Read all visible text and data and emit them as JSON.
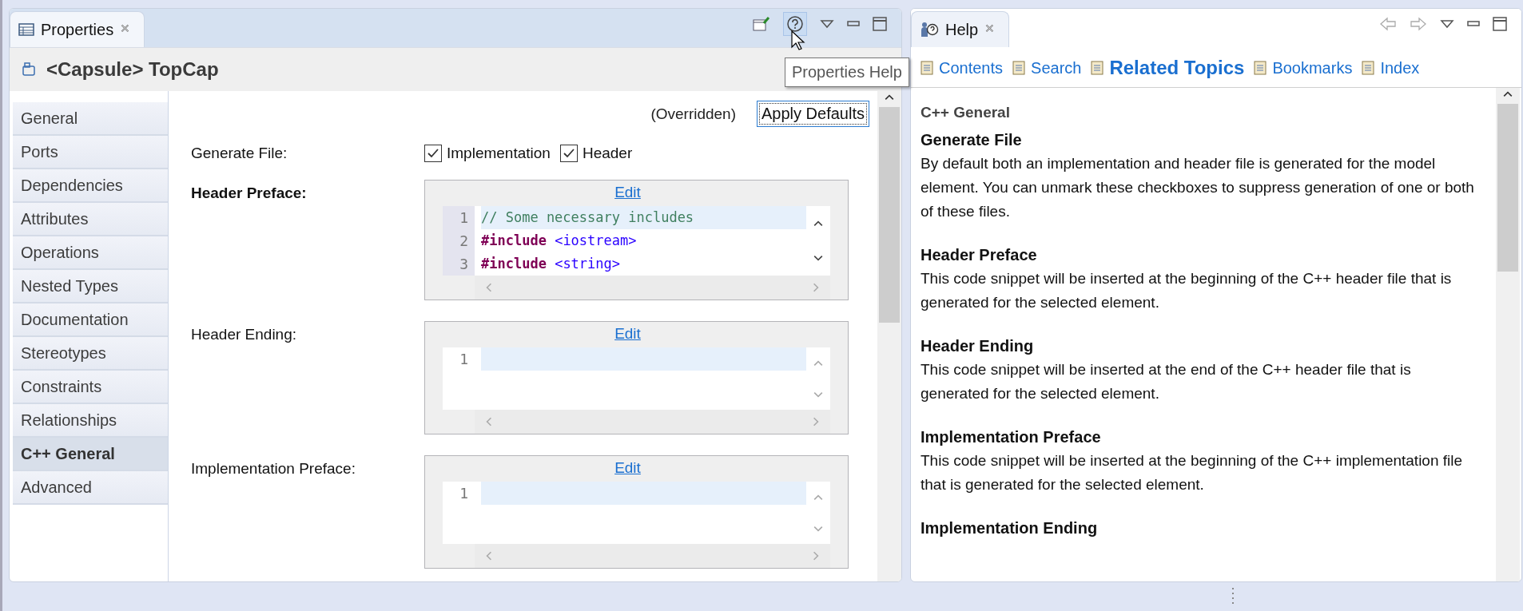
{
  "properties": {
    "tab": {
      "title": "Properties"
    },
    "heading": "<Capsule> TopCap",
    "sidebar": {
      "items": [
        {
          "label": "General",
          "selected": false
        },
        {
          "label": "Ports",
          "selected": false
        },
        {
          "label": "Dependencies",
          "selected": false
        },
        {
          "label": "Attributes",
          "selected": false
        },
        {
          "label": "Operations",
          "selected": false
        },
        {
          "label": "Nested Types",
          "selected": false
        },
        {
          "label": "Documentation",
          "selected": false
        },
        {
          "label": "Stereotypes",
          "selected": false
        },
        {
          "label": "Constraints",
          "selected": false
        },
        {
          "label": "Relationships",
          "selected": false
        },
        {
          "label": "C++ General",
          "selected": true
        },
        {
          "label": "Advanced",
          "selected": false
        }
      ]
    },
    "form": {
      "overridden_note": "(Overridden)",
      "apply_button": "Apply Defaults",
      "generate_file": {
        "label": "Generate File:",
        "options": [
          {
            "label": "Implementation",
            "checked": true
          },
          {
            "label": "Header",
            "checked": true
          }
        ]
      },
      "code_sections": [
        {
          "label": "Header Preface:",
          "emphasized": true,
          "edit_link": "Edit",
          "lines": [
            {
              "number": "1",
              "current": true,
              "tokens": [
                {
                  "kind": "comment",
                  "text": "// Some necessary includes"
                }
              ]
            },
            {
              "number": "2",
              "current": false,
              "tokens": [
                {
                  "kind": "keyword",
                  "text": "#include"
                },
                {
                  "kind": "header",
                  "text": "<iostream>"
                }
              ]
            },
            {
              "number": "3",
              "current": false,
              "tokens": [
                {
                  "kind": "keyword",
                  "text": "#include"
                },
                {
                  "kind": "header",
                  "text": "<string>"
                }
              ]
            }
          ]
        },
        {
          "label": "Header Ending:",
          "emphasized": false,
          "edit_link": "Edit",
          "lines": [
            {
              "number": "1",
              "current": true
            }
          ]
        },
        {
          "label": "Implementation Preface:",
          "emphasized": false,
          "edit_link": "Edit",
          "lines": [
            {
              "number": "1",
              "current": true
            }
          ]
        }
      ]
    }
  },
  "tooltip": "Properties Help",
  "help": {
    "tab": {
      "title": "Help"
    },
    "nav": [
      {
        "label": "Contents",
        "selected": false
      },
      {
        "label": "Search",
        "selected": false
      },
      {
        "label": "Related Topics",
        "selected": true
      },
      {
        "label": "Bookmarks",
        "selected": false
      },
      {
        "label": "Index",
        "selected": false
      }
    ],
    "topic": "C++ General",
    "sections": [
      {
        "heading": "Generate File",
        "text": "By default both an implementation and header file is generated for the model element. You can unmark these checkboxes to suppress generation of one or both of these files."
      },
      {
        "heading": "Header Preface",
        "text": "This code snippet will be inserted at the beginning of the C++ header file that is generated for the selected element."
      },
      {
        "heading": "Header Ending",
        "text": "This code snippet will be inserted at the end of the C++ header file that is generated for the selected element."
      },
      {
        "heading": "Implementation Preface",
        "text": "This code snippet will be inserted at the beginning of the C++ implementation file that is generated for the selected element."
      },
      {
        "heading": "Implementation Ending"
      }
    ]
  }
}
